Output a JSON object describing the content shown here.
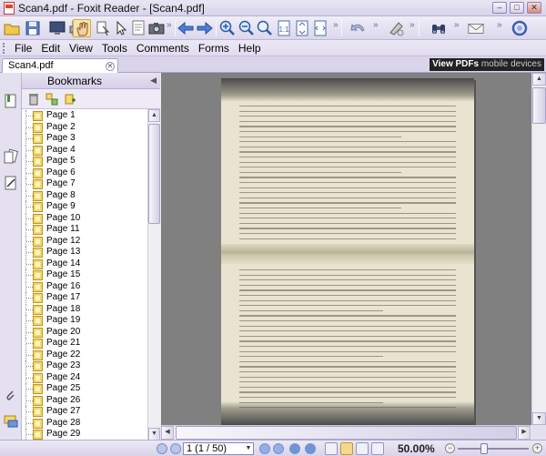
{
  "window": {
    "title": "Scan4.pdf - Foxit Reader - [Scan4.pdf]",
    "controls": {
      "minimize": "–",
      "maximize": "□",
      "close": "✕"
    }
  },
  "menu": [
    "File",
    "Edit",
    "View",
    "Tools",
    "Comments",
    "Forms",
    "Help"
  ],
  "tabs": [
    {
      "label": "Scan4.pdf"
    }
  ],
  "ad_banner": {
    "strong": "View PDFs",
    "light": "mobile devices"
  },
  "sidebar": {
    "title": "Bookmarks",
    "bookmarks": [
      "Page 1",
      "Page 2",
      "Page 3",
      "Page 4",
      "Page 5",
      "Page 6",
      "Page 7",
      "Page 8",
      "Page 9",
      "Page 10",
      "Page 11",
      "Page 12",
      "Page 13",
      "Page 14",
      "Page 15",
      "Page 16",
      "Page 17",
      "Page 18",
      "Page 19",
      "Page 20",
      "Page 21",
      "Page 22",
      "Page 23",
      "Page 24",
      "Page 25",
      "Page 26",
      "Page 27",
      "Page 28",
      "Page 29"
    ]
  },
  "status": {
    "page_field": "1 (1 / 50)",
    "zoom": "50.00%"
  }
}
